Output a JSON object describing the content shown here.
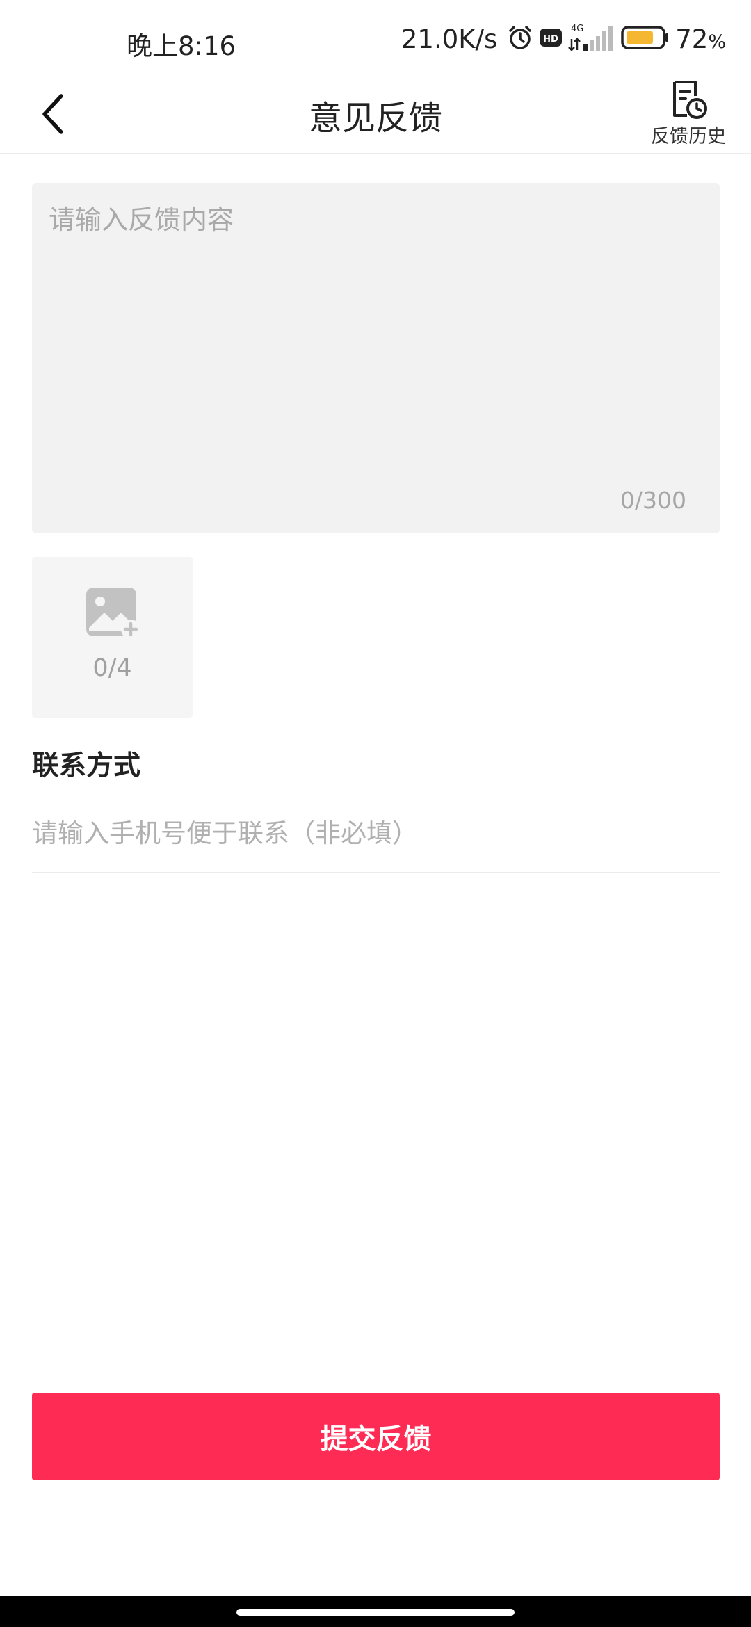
{
  "status_bar": {
    "time": "晚上8:16",
    "net_speed": "21.0K/s",
    "network_type": "4G",
    "hd_label": "HD",
    "battery_percent": "72",
    "battery_unit": "%",
    "icons": [
      "alarm-icon",
      "hd-icon",
      "signal-icon",
      "battery-icon"
    ]
  },
  "header": {
    "title": "意见反馈",
    "back_icon": "chevron-left-icon",
    "history_label": "反馈历史",
    "history_icon": "document-clock-icon"
  },
  "feedback": {
    "value": "",
    "placeholder": "请输入反馈内容",
    "char_count": "0/300"
  },
  "upload": {
    "icon": "image-add-icon",
    "count": "0/4"
  },
  "contact": {
    "label": "联系方式",
    "value": "",
    "placeholder": "请输入手机号便于联系（非必填）"
  },
  "submit": {
    "label": "提交反馈"
  },
  "colors": {
    "accent": "#fe2c55",
    "battery_fill": "#f5b72f",
    "input_bg": "#f2f2f2",
    "placeholder": "#a9a9a9"
  }
}
